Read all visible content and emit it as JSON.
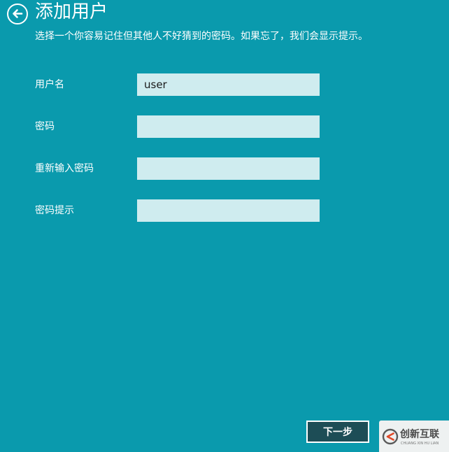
{
  "header": {
    "title": "添加用户",
    "subtitle": "选择一个你容易记住但其他人不好猜到的密码。如果忘了，我们会显示提示。",
    "back_icon": "arrow-left-circle-icon"
  },
  "form": {
    "fields": [
      {
        "label": "用户名",
        "value": "user"
      },
      {
        "label": "密码",
        "value": ""
      },
      {
        "label": "重新输入密码",
        "value": ""
      },
      {
        "label": "密码提示",
        "value": ""
      }
    ]
  },
  "footer": {
    "next_label": "下一步"
  },
  "watermark": {
    "text": "创新互联",
    "subtext": "CHUANG XIN HU LIAN"
  },
  "colors": {
    "background": "#0a9aad",
    "input_background": "#cfecef",
    "button_background": "#1d4d56"
  }
}
